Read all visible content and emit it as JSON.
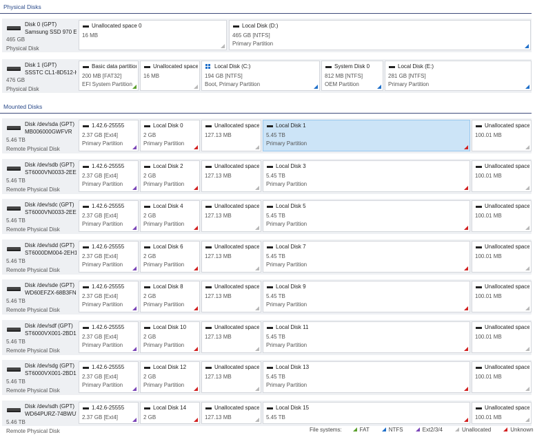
{
  "colors": {
    "fat": "#5aa02c",
    "ntfs": "#1f6fc9",
    "ext": "#7b45b8",
    "unallocated": "#b8b8b8",
    "unknown": "#d22020",
    "selected": "#cce4f7"
  },
  "sections": {
    "physical": "Physical Disks",
    "mounted": "Mounted Disks"
  },
  "legend": {
    "label": "File systems:",
    "items": [
      {
        "label": "FAT",
        "fs": "fat"
      },
      {
        "label": "NTFS",
        "fs": "ntfs"
      },
      {
        "label": "Ext2/3/4",
        "fs": "ext"
      },
      {
        "label": "Unallocated",
        "fs": "unallocated"
      },
      {
        "label": "Unknown",
        "fs": "unknown"
      }
    ]
  },
  "physical_disks": [
    {
      "name": "Disk 0 (GPT)",
      "model": "Samsung SSD 970 EVO",
      "size": "465 GB",
      "type": "Physical Disk",
      "partitions": [
        {
          "title": "Unallocated space 0",
          "size": "16 MB",
          "kind": "",
          "fs": "unallocated",
          "icon": "bar"
        },
        {
          "title": "Local Disk (D:)",
          "size": "465 GB [NTFS]",
          "kind": "Primary Partition",
          "fs": "ntfs",
          "icon": "bar"
        }
      ]
    },
    {
      "name": "Disk 1 (GPT)",
      "model": "SSSTC CL1-8D512-HP",
      "size": "476 GB",
      "type": "Physical Disk",
      "partitions": [
        {
          "title": "Basic data partition",
          "size": "200 MB [FAT32]",
          "kind": "EFI System Partition",
          "fs": "fat",
          "icon": "bar"
        },
        {
          "title": "Unallocated space",
          "size": "16 MB",
          "kind": "",
          "fs": "unallocated",
          "icon": "bar"
        },
        {
          "title": "Local Disk (C:)",
          "size": "194 GB [NTFS]",
          "kind": "Boot, Primary Partition",
          "fs": "ntfs",
          "icon": "win"
        },
        {
          "title": "System Disk 0",
          "size": "812 MB [NTFS]",
          "kind": "OEM Partition",
          "fs": "ntfs",
          "icon": "bar"
        },
        {
          "title": "Local Disk (E:)",
          "size": "281 GB [NTFS]",
          "kind": "Primary Partition",
          "fs": "ntfs",
          "icon": "bar"
        }
      ]
    }
  ],
  "mounted_disks": [
    {
      "name": "Disk /dev/sda (GPT)",
      "model": "MB006000GWFVR",
      "size": "5.46 TB",
      "type": "Remote Physical Disk",
      "partitions": [
        {
          "title": "1.42.6-25555",
          "size": "2.37 GB [Ext4]",
          "kind": "Primary Partition",
          "fs": "ext"
        },
        {
          "title": "Local Disk 0",
          "size": "2 GB",
          "kind": "Primary Partition",
          "fs": "unknown"
        },
        {
          "title": "Unallocated space",
          "size": "127.13 MB",
          "kind": "",
          "fs": "unallocated"
        },
        {
          "title": "Local Disk 1",
          "size": "5.45 TB",
          "kind": "Primary Partition",
          "fs": "unknown",
          "selected": true
        },
        {
          "title": "Unallocated space",
          "size": "100.01 MB",
          "kind": "",
          "fs": "unallocated"
        }
      ]
    },
    {
      "name": "Disk /dev/sdb (GPT)",
      "model": "ST6000VN0033-2EE110",
      "size": "5.46 TB",
      "type": "Remote Physical Disk",
      "partitions": [
        {
          "title": "1.42.6-25555",
          "size": "2.37 GB [Ext4]",
          "kind": "Primary Partition",
          "fs": "ext"
        },
        {
          "title": "Local Disk 2",
          "size": "2 GB",
          "kind": "Primary Partition",
          "fs": "unknown"
        },
        {
          "title": "Unallocated space",
          "size": "127.13 MB",
          "kind": "",
          "fs": "unallocated"
        },
        {
          "title": "Local Disk 3",
          "size": "5.45 TB",
          "kind": "Primary Partition",
          "fs": "unknown"
        },
        {
          "title": "Unallocated space",
          "size": "100.01 MB",
          "kind": "",
          "fs": "unallocated"
        }
      ]
    },
    {
      "name": "Disk /dev/sdc (GPT)",
      "model": "ST6000VN0033-2EE110",
      "size": "5.46 TB",
      "type": "Remote Physical Disk",
      "partitions": [
        {
          "title": "1.42.6-25555",
          "size": "2.37 GB [Ext4]",
          "kind": "Primary Partition",
          "fs": "ext"
        },
        {
          "title": "Local Disk 4",
          "size": "2 GB",
          "kind": "Primary Partition",
          "fs": "unknown"
        },
        {
          "title": "Unallocated space",
          "size": "127.13 MB",
          "kind": "",
          "fs": "unallocated"
        },
        {
          "title": "Local Disk 5",
          "size": "5.45 TB",
          "kind": "Primary Partition",
          "fs": "unknown"
        },
        {
          "title": "Unallocated space",
          "size": "100.01 MB",
          "kind": "",
          "fs": "unallocated"
        }
      ]
    },
    {
      "name": "Disk /dev/sdd (GPT)",
      "model": "ST6000DM004-2EH11C",
      "size": "5.46 TB",
      "type": "Remote Physical Disk",
      "partitions": [
        {
          "title": "1.42.6-25555",
          "size": "2.37 GB [Ext4]",
          "kind": "Primary Partition",
          "fs": "ext"
        },
        {
          "title": "Local Disk 6",
          "size": "2 GB",
          "kind": "Primary Partition",
          "fs": "unknown"
        },
        {
          "title": "Unallocated space",
          "size": "127.13 MB",
          "kind": "",
          "fs": "unallocated"
        },
        {
          "title": "Local Disk 7",
          "size": "5.45 TB",
          "kind": "Primary Partition",
          "fs": "unknown"
        },
        {
          "title": "Unallocated space",
          "size": "100.01 MB",
          "kind": "",
          "fs": "unallocated"
        }
      ]
    },
    {
      "name": "Disk /dev/sde (GPT)",
      "model": "WD60EFZX-68B3FN0",
      "size": "5.46 TB",
      "type": "Remote Physical Disk",
      "partitions": [
        {
          "title": "1.42.6-25555",
          "size": "2.37 GB [Ext4]",
          "kind": "Primary Partition",
          "fs": "ext"
        },
        {
          "title": "Local Disk 8",
          "size": "2 GB",
          "kind": "Primary Partition",
          "fs": "unknown"
        },
        {
          "title": "Unallocated space",
          "size": "127.13 MB",
          "kind": "",
          "fs": "unallocated"
        },
        {
          "title": "Local Disk 9",
          "size": "5.45 TB",
          "kind": "Primary Partition",
          "fs": "unknown"
        },
        {
          "title": "Unallocated space",
          "size": "100.01 MB",
          "kind": "",
          "fs": "unallocated"
        }
      ]
    },
    {
      "name": "Disk /dev/sdf (GPT)",
      "model": "ST6000VX001-2BD186",
      "size": "5.46 TB",
      "type": "Remote Physical Disk",
      "partitions": [
        {
          "title": "1.42.6-25555",
          "size": "2.37 GB [Ext4]",
          "kind": "Primary Partition",
          "fs": "ext"
        },
        {
          "title": "Local Disk 10",
          "size": "2 GB",
          "kind": "Primary Partition",
          "fs": "unknown"
        },
        {
          "title": "Unallocated space",
          "size": "127.13 MB",
          "kind": "",
          "fs": "unallocated"
        },
        {
          "title": "Local Disk 11",
          "size": "5.45 TB",
          "kind": "Primary Partition",
          "fs": "unknown"
        },
        {
          "title": "Unallocated space",
          "size": "100.01 MB",
          "kind": "",
          "fs": "unallocated"
        }
      ]
    },
    {
      "name": "Disk /dev/sdg (GPT)",
      "model": "ST6000VX001-2BD186",
      "size": "5.46 TB",
      "type": "Remote Physical Disk",
      "partitions": [
        {
          "title": "1.42.6-25555",
          "size": "2.37 GB [Ext4]",
          "kind": "Primary Partition",
          "fs": "ext"
        },
        {
          "title": "Local Disk 12",
          "size": "2 GB",
          "kind": "Primary Partition",
          "fs": "unknown"
        },
        {
          "title": "Unallocated space",
          "size": "127.13 MB",
          "kind": "",
          "fs": "unallocated"
        },
        {
          "title": "Local Disk 13",
          "size": "5.45 TB",
          "kind": "Primary Partition",
          "fs": "unknown"
        },
        {
          "title": "Unallocated space",
          "size": "100.01 MB",
          "kind": "",
          "fs": "unallocated"
        }
      ]
    },
    {
      "name": "Disk /dev/sdh (GPT)",
      "model": "WD64PURZ-74BWUY0",
      "size": "5.46 TB",
      "type": "Remote Physical Disk",
      "partitions": [
        {
          "title": "1.42.6-25555",
          "size": "2.37 GB [Ext4]",
          "kind": "Primary Partition",
          "fs": "ext"
        },
        {
          "title": "Local Disk 14",
          "size": "2 GB",
          "kind": "Primary Partition",
          "fs": "unknown"
        },
        {
          "title": "Unallocated space",
          "size": "127.13 MB",
          "kind": "",
          "fs": "unallocated"
        },
        {
          "title": "Local Disk 15",
          "size": "5.45 TB",
          "kind": "Primary Partition",
          "fs": "unknown"
        },
        {
          "title": "Unallocated space",
          "size": "100.01 MB",
          "kind": "",
          "fs": "unallocated"
        }
      ]
    }
  ]
}
